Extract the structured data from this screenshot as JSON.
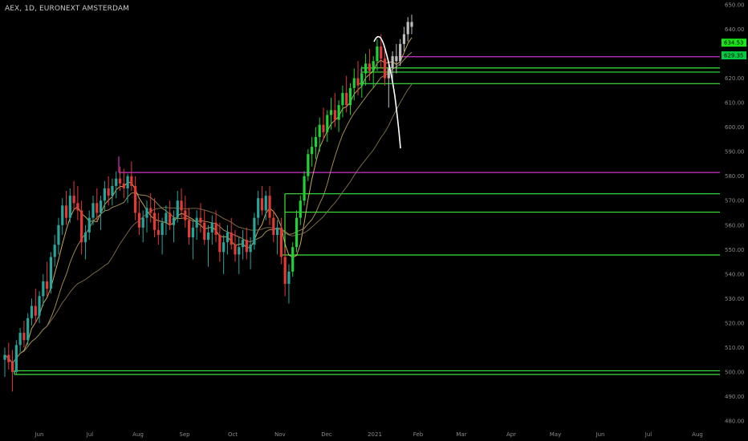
{
  "header": {
    "title": "AEX, 1D, EURONEXT AMSTERDAM"
  },
  "colors": {
    "background": "#000000",
    "up": "#26a69a",
    "up_bright": "#1fd336",
    "down": "#e53935",
    "neutral": "#bdbdbd",
    "purple": "#cc33cc",
    "green_line": "#3ee63e",
    "ma_fast": "#e8c56a",
    "ma_mid": "#b8a060",
    "ma_slow": "#8a7a50",
    "drawing": "#ffffff",
    "axis_text": "#8a8a8a",
    "price_tag_1": "#19e619",
    "price_tag_2": "#00cc44"
  },
  "chart_data": {
    "type": "candlestick",
    "title": "AEX, 1D, EURONEXT AMSTERDAM",
    "ylim": [
      480,
      650
    ],
    "y_ticks": [
      "650.00",
      "640.00",
      "630.00",
      "620.00",
      "610.00",
      "600.00",
      "590.00",
      "580.00",
      "570.00",
      "560.00",
      "550.00",
      "540.00",
      "530.00",
      "520.00",
      "510.00",
      "500.00",
      "490.00",
      "480.00"
    ],
    "x_ticks": [
      "Jun",
      "Jul",
      "Aug",
      "Sep",
      "Oct",
      "Nov",
      "Dec",
      "2021",
      "Feb",
      "Mar",
      "Apr",
      "May",
      "Jun",
      "Jul",
      "Aug"
    ],
    "price_labels": [
      {
        "text": "634.53",
        "value": 634.53
      },
      {
        "text": "629.35",
        "value": 629.35
      }
    ],
    "horizontal_levels": [
      {
        "value": 628.8,
        "color": "purple",
        "from": "2021-01-08"
      },
      {
        "value": 624.2,
        "color": "green",
        "from": "2020-12-29"
      },
      {
        "value": 622.5,
        "color": "green",
        "from": "2020-12-29"
      },
      {
        "value": 617.8,
        "color": "green",
        "from": "2020-12-23"
      },
      {
        "value": 581.5,
        "color": "purple",
        "from": "2020-07-20"
      },
      {
        "value": 572.8,
        "color": "green",
        "from": "2020-11-02"
      },
      {
        "value": 565.3,
        "color": "green",
        "from": "2020-11-02"
      },
      {
        "value": 547.8,
        "color": "green",
        "from": "2020-11-02"
      },
      {
        "value": 500.5,
        "color": "green",
        "from": "2020-05-18"
      },
      {
        "value": 499.0,
        "color": "green",
        "from": "2020-05-18"
      }
    ],
    "series": [
      {
        "name": "",
        "kind": "candles",
        "points": [
          [
            505,
            510,
            498,
            507
          ],
          [
            507,
            512,
            501,
            504
          ],
          [
            504,
            509,
            492,
            500
          ],
          [
            500,
            513,
            499,
            511
          ],
          [
            511,
            518,
            508,
            516
          ],
          [
            516,
            521,
            510,
            513
          ],
          [
            513,
            524,
            511,
            522
          ],
          [
            522,
            530,
            519,
            527
          ],
          [
            527,
            534,
            520,
            523
          ],
          [
            523,
            533,
            520,
            531
          ],
          [
            531,
            540,
            527,
            537
          ],
          [
            537,
            545,
            531,
            534
          ],
          [
            534,
            549,
            532,
            547
          ],
          [
            547,
            556,
            543,
            552
          ],
          [
            552,
            563,
            548,
            560
          ],
          [
            560,
            571,
            556,
            568
          ],
          [
            568,
            574,
            560,
            563
          ],
          [
            563,
            575,
            561,
            572
          ],
          [
            572,
            578,
            566,
            569
          ],
          [
            569,
            576,
            562,
            566
          ],
          [
            566,
            570,
            548,
            553
          ],
          [
            553,
            560,
            546,
            557
          ],
          [
            557,
            566,
            554,
            563
          ],
          [
            563,
            572,
            560,
            569
          ],
          [
            569,
            575,
            562,
            565
          ],
          [
            565,
            572,
            558,
            570
          ],
          [
            570,
            578,
            566,
            575
          ],
          [
            575,
            580,
            568,
            572
          ],
          [
            572,
            579,
            568,
            576
          ],
          [
            576,
            582,
            571,
            579
          ],
          [
            579,
            584,
            574,
            577
          ],
          [
            577,
            583,
            571,
            575
          ],
          [
            575,
            581,
            569,
            580
          ],
          [
            580,
            586,
            574,
            576
          ],
          [
            576,
            580,
            562,
            565
          ],
          [
            565,
            570,
            556,
            559
          ],
          [
            559,
            566,
            553,
            563
          ],
          [
            563,
            570,
            557,
            567
          ],
          [
            567,
            573,
            561,
            565
          ],
          [
            565,
            571,
            555,
            558
          ],
          [
            558,
            565,
            552,
            556
          ],
          [
            556,
            563,
            548,
            561
          ],
          [
            561,
            568,
            556,
            565
          ],
          [
            565,
            570,
            558,
            560
          ],
          [
            560,
            566,
            553,
            563
          ],
          [
            563,
            574,
            561,
            570
          ],
          [
            570,
            575,
            563,
            566
          ],
          [
            566,
            572,
            559,
            562
          ],
          [
            562,
            567,
            552,
            555
          ],
          [
            555,
            562,
            546,
            559
          ],
          [
            559,
            566,
            554,
            563
          ],
          [
            563,
            569,
            557,
            561
          ],
          [
            561,
            566,
            552,
            554
          ],
          [
            554,
            560,
            543,
            557
          ],
          [
            557,
            564,
            552,
            561
          ],
          [
            561,
            566,
            553,
            556
          ],
          [
            556,
            561,
            545,
            549
          ],
          [
            549,
            556,
            540,
            553
          ],
          [
            553,
            560,
            548,
            557
          ],
          [
            557,
            563,
            550,
            552
          ],
          [
            552,
            558,
            545,
            548
          ],
          [
            548,
            555,
            540,
            551
          ],
          [
            551,
            558,
            546,
            554
          ],
          [
            554,
            559,
            546,
            549
          ],
          [
            549,
            555,
            542,
            552
          ],
          [
            552,
            565,
            550,
            563
          ],
          [
            563,
            574,
            560,
            571
          ],
          [
            571,
            576,
            564,
            566
          ],
          [
            566,
            574,
            562,
            572
          ],
          [
            572,
            576,
            560,
            563
          ],
          [
            563,
            566,
            553,
            556
          ],
          [
            556,
            562,
            548,
            559
          ],
          [
            559,
            563,
            544,
            547
          ],
          [
            547,
            551,
            531,
            536
          ],
          [
            536,
            544,
            528,
            541
          ],
          [
            541,
            553,
            539,
            551
          ],
          [
            551,
            566,
            549,
            563
          ],
          [
            563,
            572,
            560,
            570
          ],
          [
            570,
            582,
            568,
            580
          ],
          [
            580,
            591,
            578,
            589
          ],
          [
            589,
            596,
            584,
            592
          ],
          [
            592,
            600,
            587,
            596
          ],
          [
            596,
            604,
            590,
            601
          ],
          [
            601,
            608,
            595,
            598
          ],
          [
            598,
            607,
            594,
            605
          ],
          [
            605,
            612,
            599,
            607
          ],
          [
            607,
            614,
            600,
            603
          ],
          [
            603,
            611,
            598,
            609
          ],
          [
            609,
            617,
            604,
            614
          ],
          [
            614,
            621,
            606,
            609
          ],
          [
            609,
            618,
            605,
            616
          ],
          [
            616,
            624,
            611,
            620
          ],
          [
            620,
            627,
            613,
            617
          ],
          [
            617,
            625,
            612,
            622
          ],
          [
            622,
            630,
            617,
            626
          ],
          [
            626,
            632,
            619,
            623
          ],
          [
            623,
            629,
            616,
            627
          ],
          [
            627,
            636,
            623,
            633
          ],
          [
            633,
            638,
            624,
            628
          ],
          [
            628,
            632,
            617,
            620
          ],
          [
            620,
            627,
            608,
            624
          ],
          [
            624,
            631,
            619,
            629
          ],
          [
            629,
            634,
            622,
            627
          ],
          [
            627,
            636,
            625,
            634
          ],
          [
            634,
            641,
            631,
            638
          ],
          [
            638,
            645,
            635,
            643
          ],
          [
            643,
            646,
            638,
            641
          ]
        ]
      },
      {
        "name": "",
        "kind": "ma",
        "color": "ma_fast"
      },
      {
        "name": "",
        "kind": "ma",
        "color": "ma_mid"
      },
      {
        "name": "",
        "kind": "ma",
        "color": "ma_slow"
      }
    ],
    "grid": false,
    "legend": "none"
  }
}
